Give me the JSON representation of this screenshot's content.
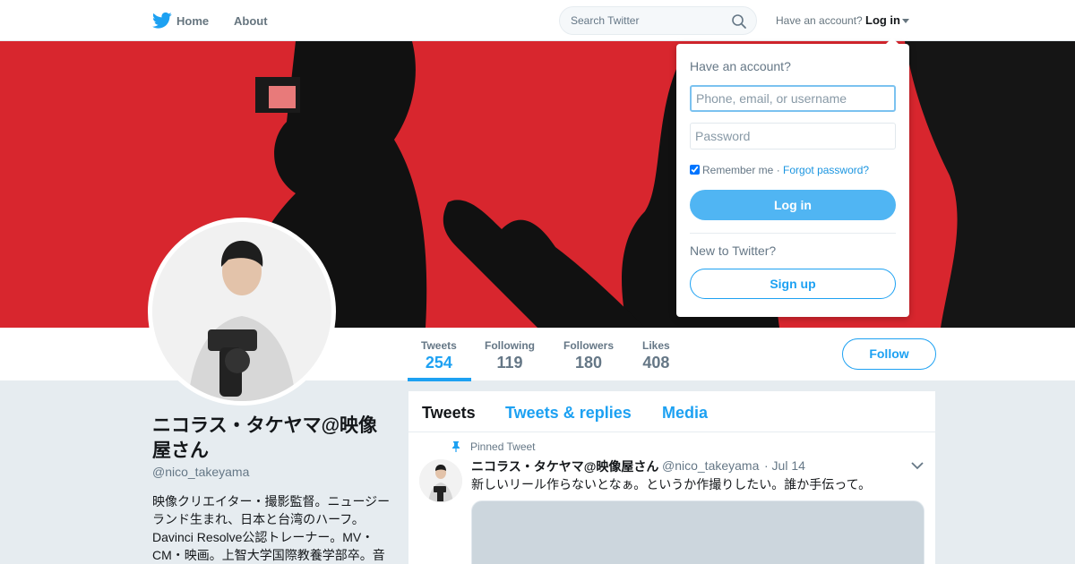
{
  "colors": {
    "brand": "#1da1f2",
    "banner": "#d8262e",
    "page_bg": "#e6ecf0"
  },
  "nav": {
    "logo_icon": "twitter-bird-icon",
    "home_label": "Home",
    "about_label": "About",
    "search_placeholder": "Search Twitter",
    "search_icon": "search-icon",
    "have_account": "Have an account?",
    "login_label": "Log in"
  },
  "profile": {
    "name": "ニコラス・タケヤマ@映像屋さん",
    "handle": "@nico_takeyama",
    "bio": "映像クリエイター・撮影監督。ニュージーランド生まれ、日本と台湾のハーフ。Davinci Resolve公認トレーナー。MV・CM・映画。上智大学国際教養学部卒。音",
    "stats": [
      {
        "label": "Tweets",
        "value": "254"
      },
      {
        "label": "Following",
        "value": "119"
      },
      {
        "label": "Followers",
        "value": "180"
      },
      {
        "label": "Likes",
        "value": "408"
      }
    ],
    "follow_label": "Follow"
  },
  "timeline": {
    "tabs": [
      "Tweets",
      "Tweets & replies",
      "Media"
    ],
    "pinned_label": "Pinned Tweet",
    "tweet": {
      "name": "ニコラス・タケヤマ@映像屋さん",
      "handle": "@nico_takeyama",
      "time": "· Jul 14",
      "text": "新しいリール作らないとなぁ。というか作撮りしたい。誰か手伝って。"
    }
  },
  "login_dropdown": {
    "title": "Have an account?",
    "username_placeholder": "Phone, email, or username",
    "password_placeholder": "Password",
    "remember_label": "Remember me",
    "separator": "·",
    "forgot_label": "Forgot password?",
    "login_button": "Log in",
    "new_to": "New to Twitter?",
    "signup_button": "Sign up"
  }
}
